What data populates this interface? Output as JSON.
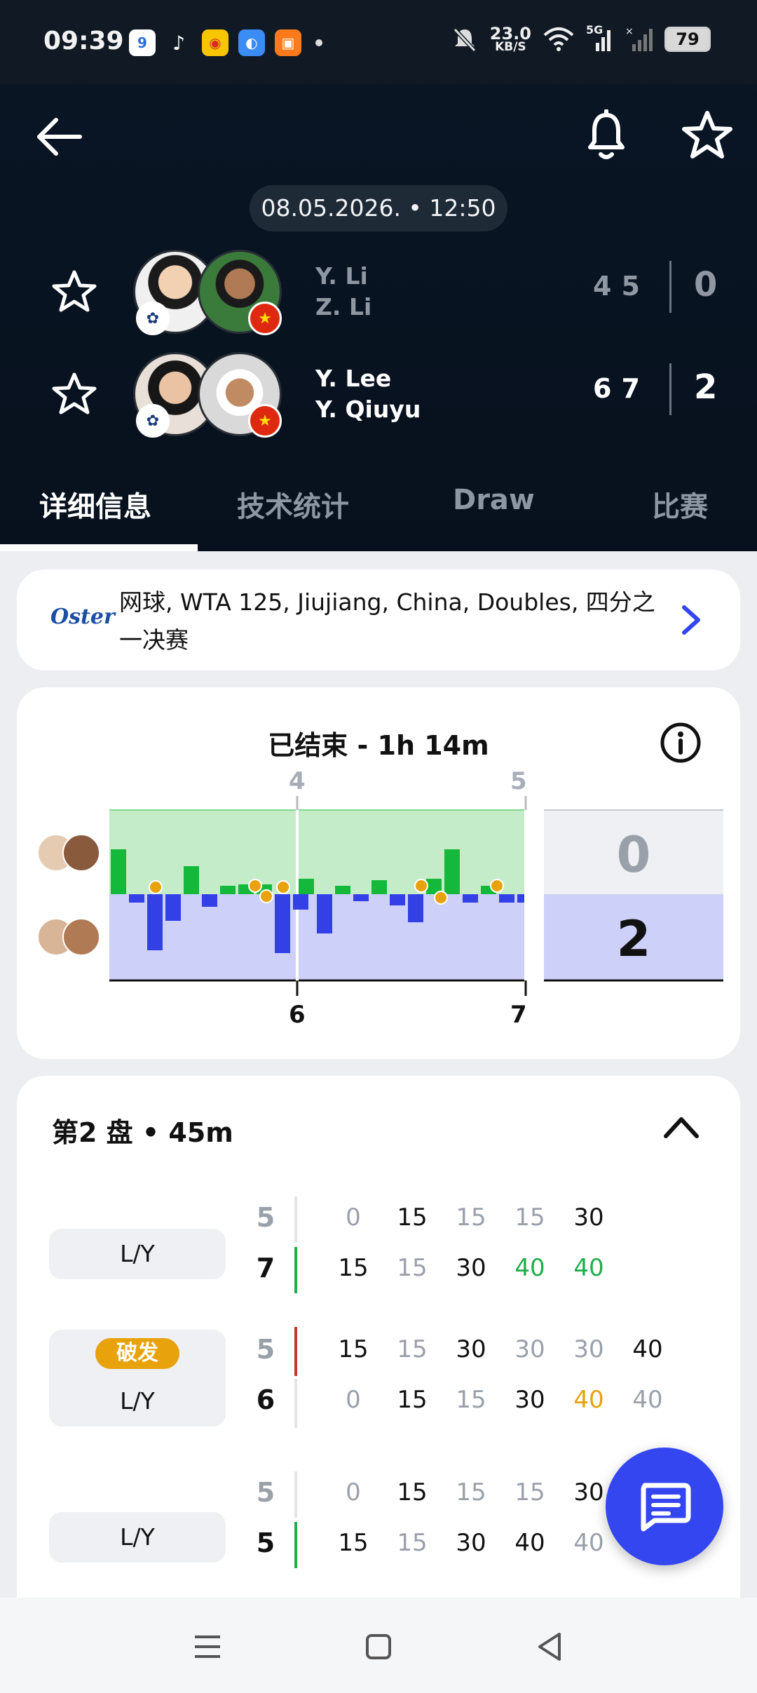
{
  "status_bar": {
    "time": "09:39",
    "app_icons": [
      "calendar-icon",
      "tiktok-icon",
      "weibo-icon",
      "browser-icon",
      "shopping-icon"
    ],
    "net_speed": "23.0",
    "net_unit": "KB/S",
    "network": "5G",
    "battery": "79"
  },
  "header": {
    "date_time": "08.05.2026. • 12:50",
    "teams": [
      {
        "players": [
          "Y. Li",
          "Z. Li"
        ],
        "games": [
          "4",
          "5"
        ],
        "sets": "0",
        "flags": [
          "TPE",
          "CHN"
        ]
      },
      {
        "players": [
          "Y. Lee",
          "Y. Qiuyu"
        ],
        "games": [
          "6",
          "7"
        ],
        "sets": "2",
        "flags": [
          "TPE",
          "CHN"
        ]
      }
    ]
  },
  "tabs": [
    {
      "label": "详细信息",
      "active": true
    },
    {
      "label": "技术统计",
      "active": false
    },
    {
      "label": "Draw",
      "active": false
    },
    {
      "label": "比赛",
      "active": false
    }
  ],
  "tournament": {
    "sponsor": "Oster",
    "text": "网球, WTA 125, Jiujiang, China, Doubles, 四分之一决赛"
  },
  "momentum": {
    "title": "已结束 - 1h 14m",
    "top_set_games": [
      "4",
      "5"
    ],
    "bottom_set_games": [
      "6",
      "7"
    ],
    "set_scores": [
      "0",
      "2"
    ]
  },
  "set_detail": {
    "title": "第2 盘 • 45m",
    "games": [
      {
        "label": "L/Y",
        "badge": "",
        "top_score": "5",
        "bottom_score": "7",
        "server_color": "#1fae4c",
        "server_row": "bottom",
        "top_points": [
          "0",
          "15",
          "15",
          "15",
          "30"
        ],
        "bottom_points": [
          "15",
          "15",
          "30",
          "40",
          "40"
        ]
      },
      {
        "label": "L/Y",
        "badge": "破发",
        "top_score": "5",
        "bottom_score": "6",
        "server_color": "#c0392b",
        "server_row": "top",
        "top_points": [
          "15",
          "15",
          "30",
          "30",
          "30",
          "40"
        ],
        "bottom_points": [
          "0",
          "15",
          "15",
          "30",
          "40",
          "40"
        ]
      },
      {
        "label": "L/Y",
        "badge": "",
        "top_score": "5",
        "bottom_score": "5",
        "server_color": "#1fae4c",
        "server_row": "bottom",
        "top_points": [
          "0",
          "15",
          "15",
          "15",
          "30"
        ],
        "bottom_points": [
          "15",
          "15",
          "30",
          "40",
          "40"
        ]
      }
    ]
  },
  "colors": {
    "accent_blue": "#3446f0",
    "momentum_green": "#14b83a",
    "momentum_blue": "#3340e6",
    "break_badge": "#e8a20c"
  }
}
